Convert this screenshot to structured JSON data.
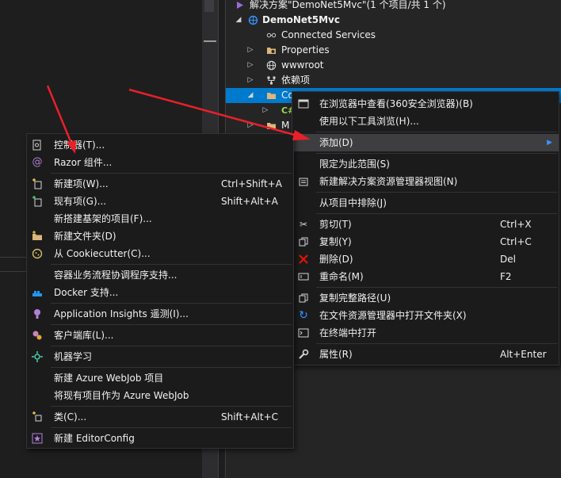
{
  "solution_explorer": {
    "solution_label": "解决方案\"DemoNet5Mvc\"(1 个项目/共 1 个)",
    "project_label": "DemoNet5Mvc",
    "items": [
      {
        "label": "Connected Services",
        "icon": "connected-services-icon"
      },
      {
        "label": "Properties",
        "icon": "properties-folder-icon"
      },
      {
        "label": "wwwroot",
        "icon": "globe-icon"
      },
      {
        "label": "依赖项",
        "icon": "dependencies-icon"
      },
      {
        "label": "Co",
        "icon": "folder-open-icon",
        "selected": true
      },
      {
        "label": "",
        "icon": "csharp-file-icon"
      },
      {
        "label": "M",
        "icon": "folder-icon"
      }
    ]
  },
  "context_menu": {
    "items": [
      {
        "label": "在浏览器中查看(360安全浏览器)(B)",
        "shortcut": "",
        "icon": "browse-icon"
      },
      {
        "label": "使用以下工具浏览(H)...",
        "shortcut": "",
        "icon": ""
      },
      {
        "label": "添加(D)",
        "shortcut": "",
        "icon": "",
        "submenu_arrow": "▶",
        "highlighted": true
      },
      {
        "label": "限定为此范围(S)",
        "shortcut": "",
        "icon": ""
      },
      {
        "label": "新建解决方案资源管理器视图(N)",
        "shortcut": "",
        "icon": "new-view-icon"
      },
      {
        "label": "从项目中排除(J)",
        "shortcut": "",
        "icon": ""
      },
      {
        "label": "剪切(T)",
        "shortcut": "Ctrl+X",
        "icon": "cut-icon"
      },
      {
        "label": "复制(Y)",
        "shortcut": "Ctrl+C",
        "icon": "copy-icon"
      },
      {
        "label": "删除(D)",
        "shortcut": "Del",
        "icon": "delete-icon"
      },
      {
        "label": "重命名(M)",
        "shortcut": "F2",
        "icon": "rename-icon"
      },
      {
        "label": "复制完整路径(U)",
        "shortcut": "",
        "icon": "copy-path-icon"
      },
      {
        "label": "在文件资源管理器中打开文件夹(X)",
        "shortcut": "",
        "icon": "refresh-folder-icon"
      },
      {
        "label": "在终端中打开",
        "shortcut": "",
        "icon": "terminal-icon"
      },
      {
        "label": "属性(R)",
        "shortcut": "Alt+Enter",
        "icon": "wrench-icon"
      }
    ]
  },
  "add_submenu": {
    "items": [
      {
        "label": "控制器(T)...",
        "shortcut": "",
        "icon": "controller-icon"
      },
      {
        "label": "Razor 组件...",
        "shortcut": "",
        "icon": "razor-icon"
      },
      {
        "label": "新建项(W)...",
        "shortcut": "Ctrl+Shift+A",
        "icon": "new-item-icon"
      },
      {
        "label": "现有项(G)...",
        "shortcut": "Shift+Alt+A",
        "icon": "existing-item-icon"
      },
      {
        "label": "新搭建基架的项目(F)...",
        "shortcut": "",
        "icon": ""
      },
      {
        "label": "新建文件夹(D)",
        "shortcut": "",
        "icon": "new-folder-icon"
      },
      {
        "label": "从 Cookiecutter(C)...",
        "shortcut": "",
        "icon": "cookiecutter-icon"
      },
      {
        "label": "容器业务流程协调程序支持...",
        "shortcut": "",
        "icon": ""
      },
      {
        "label": "Docker 支持...",
        "shortcut": "",
        "icon": "docker-icon"
      },
      {
        "label": "Application Insights 遥测(I)...",
        "shortcut": "",
        "icon": "app-insights-icon"
      },
      {
        "label": "客户端库(L)...",
        "shortcut": "",
        "icon": "client-library-icon"
      },
      {
        "label": "机器学习",
        "shortcut": "",
        "icon": "machine-learning-icon"
      },
      {
        "label": "新建 Azure WebJob 项目",
        "shortcut": "",
        "icon": ""
      },
      {
        "label": "将现有项目作为 Azure WebJob",
        "shortcut": "",
        "icon": ""
      },
      {
        "label": "类(C)...",
        "shortcut": "Shift+Alt+C",
        "icon": "class-icon"
      },
      {
        "label": "新建 EditorConfig",
        "shortcut": "",
        "icon": "editorconfig-icon"
      }
    ]
  },
  "colors": {
    "selection": "#007acc",
    "menu_bg": "#1b1b1c",
    "arrow": "#e8202a",
    "accent_arrow": "#3794ff"
  }
}
